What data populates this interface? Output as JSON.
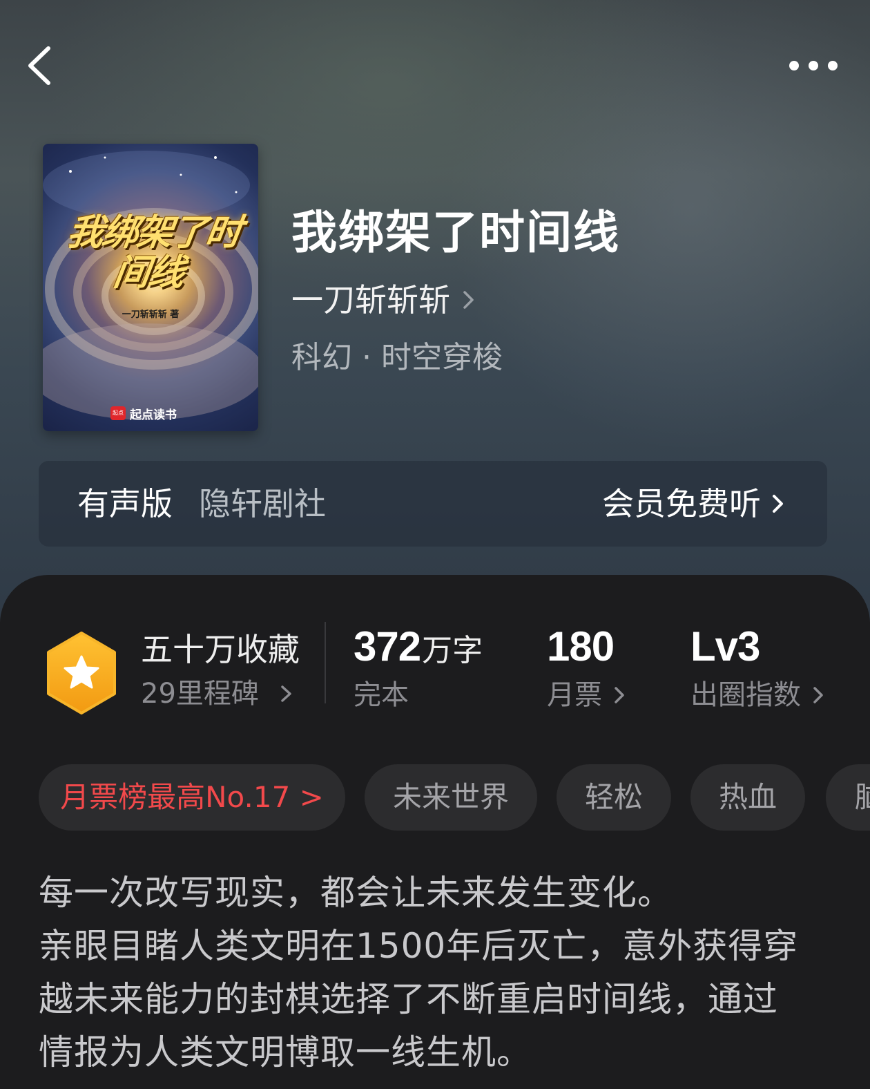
{
  "header": {
    "back_icon": "chevron-left-icon",
    "more_icon": "more-horizontal-icon"
  },
  "cover": {
    "title": "我绑架了时间线",
    "author": "一刀斩斩斩 著",
    "brand": "起点读书",
    "brand_logo": "起点"
  },
  "book": {
    "title": "我绑架了时间线",
    "author": "一刀斩斩斩",
    "category": "科幻 · 时空穿梭"
  },
  "audio": {
    "label": "有声版",
    "publisher": "隐轩剧社",
    "action": "会员免费听"
  },
  "stats": {
    "favorites": "五十万收藏",
    "milestones": "29里程碑",
    "words_num": "372",
    "words_unit": "万字",
    "status": "完本",
    "monthly_votes": "180",
    "monthly_votes_label": "月票",
    "level": "Lv3",
    "level_label": "出圈指数"
  },
  "tags": [
    "月票榜最高No.17 >",
    "未来世界",
    "轻松",
    "热血",
    "脑"
  ],
  "description": [
    "每一次改写现实，都会让未来发生变化。",
    "亲眼目睹人类文明在1500年后灭亡，意外获得穿",
    "越未来能力的封棋选择了不断重启时间线，通过",
    "情报为人类文明博取一线生机。"
  ],
  "colors": {
    "rank_tag": "#f2494b",
    "badge": "#f5a623",
    "sheet_bg": "#1c1c1e"
  }
}
